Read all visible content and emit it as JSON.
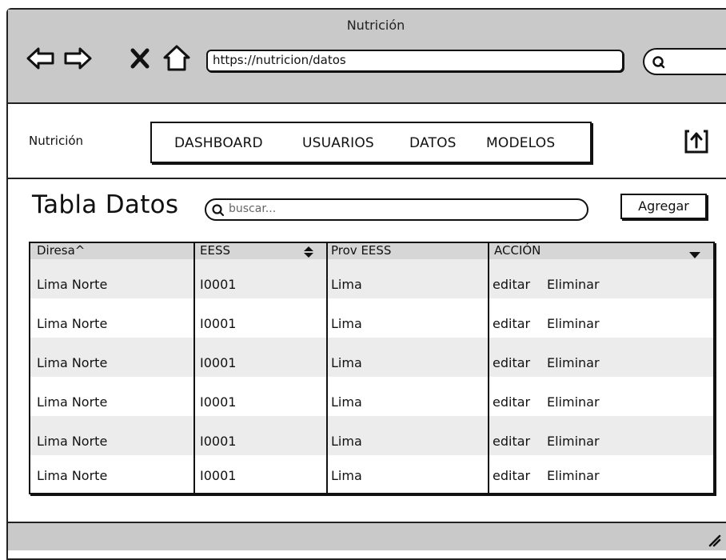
{
  "window": {
    "title": "Nutrición"
  },
  "browser": {
    "url": "https://nutricion/datos"
  },
  "header": {
    "app_name": "Nutrición",
    "menu": [
      "DASHBOARD",
      "USUARIOS",
      "DATOS",
      "MODELOS"
    ]
  },
  "page": {
    "title": "Tabla Datos"
  },
  "search": {
    "placeholder": "buscar..."
  },
  "toolbar": {
    "add_label": "Agregar"
  },
  "table": {
    "columns": [
      "Diresa^",
      "EESS",
      "Prov EESS",
      "ACCIÓN"
    ],
    "rows": [
      {
        "diresa": "Lima Norte",
        "eess": "I0001",
        "prov": "Lima",
        "edit": "editar",
        "delete": "Eliminar"
      },
      {
        "diresa": "Lima Norte",
        "eess": "I0001",
        "prov": "Lima",
        "edit": "editar",
        "delete": "Eliminar"
      },
      {
        "diresa": "Lima Norte",
        "eess": "I0001",
        "prov": "Lima",
        "edit": "editar",
        "delete": "Eliminar"
      },
      {
        "diresa": "Lima Norte",
        "eess": "I0001",
        "prov": "Lima",
        "edit": "editar",
        "delete": "Eliminar"
      },
      {
        "diresa": "Lima Norte",
        "eess": "I0001",
        "prov": "Lima",
        "edit": "editar",
        "delete": "Eliminar"
      },
      {
        "diresa": "Lima Norte",
        "eess": "I0001",
        "prov": "Lima",
        "edit": "editar",
        "delete": "Eliminar"
      }
    ]
  },
  "icons": [
    "back-arrow-icon",
    "forward-arrow-icon",
    "close-icon",
    "home-icon",
    "search-icon",
    "upload-icon",
    "sort-icon",
    "dropdown-icon",
    "resize-icon"
  ],
  "colors": {
    "chrome_gray": "#c9c9c9",
    "row_alt": "#ececec",
    "header_gray": "#d6d6d6",
    "ink": "#111111"
  }
}
